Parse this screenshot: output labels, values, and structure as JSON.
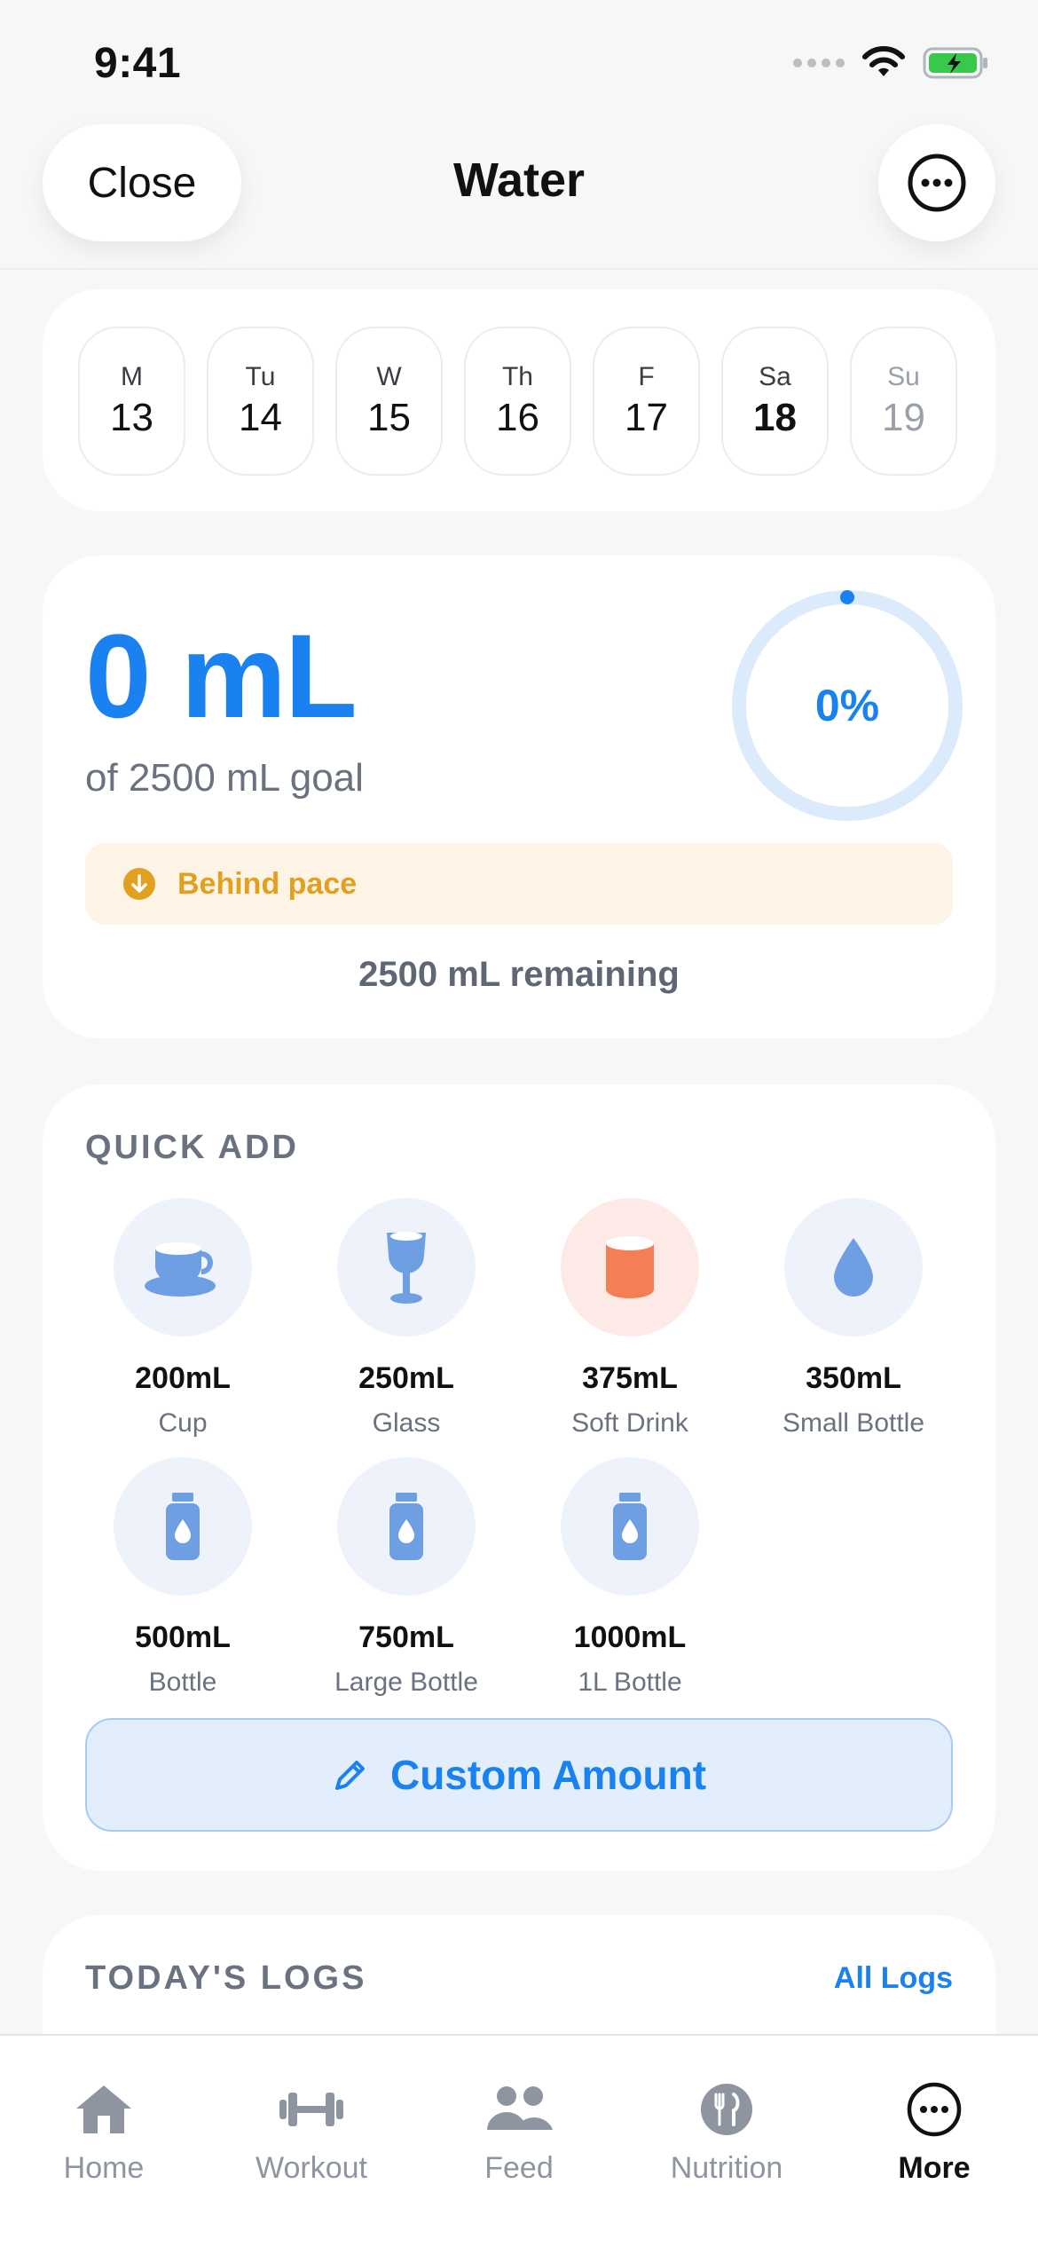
{
  "status_bar": {
    "time": "9:41"
  },
  "header": {
    "close_label": "Close",
    "title": "Water"
  },
  "week": {
    "days": [
      {
        "name": "M",
        "num": "13"
      },
      {
        "name": "Tu",
        "num": "14"
      },
      {
        "name": "W",
        "num": "15"
      },
      {
        "name": "Th",
        "num": "16"
      },
      {
        "name": "F",
        "num": "17"
      },
      {
        "name": "Sa",
        "num": "18"
      },
      {
        "name": "Su",
        "num": "19"
      }
    ]
  },
  "summary": {
    "amount": "0 mL",
    "goal": "of 2500 mL goal",
    "progress_label": "0%",
    "progress": 0,
    "pace": "Behind pace",
    "remaining": "2500 mL remaining"
  },
  "quick_add": {
    "label": "QUICK ADD",
    "items": [
      {
        "amount": "200mL",
        "name": "Cup"
      },
      {
        "amount": "250mL",
        "name": "Glass"
      },
      {
        "amount": "375mL",
        "name": "Soft Drink"
      },
      {
        "amount": "350mL",
        "name": "Small Bottle"
      },
      {
        "amount": "500mL",
        "name": "Bottle"
      },
      {
        "amount": "750mL",
        "name": "Large Bottle"
      },
      {
        "amount": "1000mL",
        "name": "1L Bottle"
      }
    ],
    "custom_label": "Custom Amount"
  },
  "logs": {
    "label": "TODAY'S LOGS",
    "all_logs": "All Logs"
  },
  "tabbar": {
    "items": [
      {
        "label": "Home"
      },
      {
        "label": "Workout"
      },
      {
        "label": "Feed"
      },
      {
        "label": "Nutrition"
      },
      {
        "label": "More"
      }
    ]
  },
  "colors": {
    "accent": "#1a82f0",
    "pace_warning": "#e2a020",
    "soft_drink": "#f47f55",
    "icon_blue": "#6f9fe3"
  }
}
